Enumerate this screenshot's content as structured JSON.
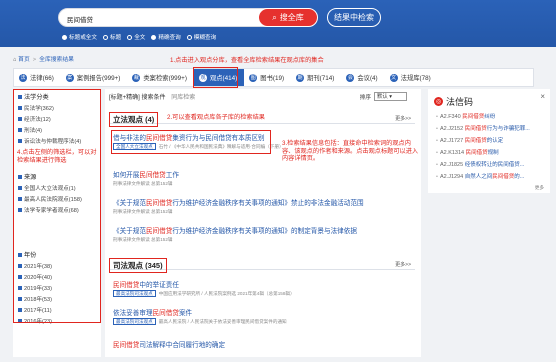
{
  "search": {
    "value": "民间借贷",
    "button": "搜全库",
    "within": "结果中检索"
  },
  "search_options": [
    {
      "label": "标题或全文",
      "checked": true
    },
    {
      "label": "标题",
      "checked": false
    },
    {
      "label": "全文",
      "checked": false
    },
    {
      "label": "精确查询",
      "checked": true
    },
    {
      "label": "模糊查询",
      "checked": false
    }
  ],
  "breadcrumb": {
    "home": "首页",
    "current": "全库搜索结果"
  },
  "annotations": {
    "a1": "1.点击进入观点分库，查看全库检索结果在观点库的集合",
    "a2": "2.可以查看观点库各子库的检索结果",
    "a3": "3.检索结果信息包括：直接命中检索词的观点内容、该观点的作者和来源。点击观点标题可以进入内容详情页。",
    "a4": "4.点击左侧的筛选栏，可以对检索结果进行筛选"
  },
  "tabs": [
    {
      "icon": "法",
      "label": "法律(66)"
    },
    {
      "icon": "案",
      "label": "案例报告(999+)"
    },
    {
      "icon": "裁",
      "label": "类案检索(999+)"
    },
    {
      "icon": "观",
      "label": "观点(414)",
      "active": true
    },
    {
      "icon": "图",
      "label": "图书(19)"
    },
    {
      "icon": "期",
      "label": "期刊(714)"
    },
    {
      "icon": "会",
      "label": "会议(4)"
    },
    {
      "icon": "文",
      "label": "法规库(78)"
    }
  ],
  "toolbar": {
    "left": "[标题+精确] 搜索条件",
    "tip": "同库检索",
    "sort_label": "排序",
    "sort_value": "默认"
  },
  "sidebar": {
    "group1": {
      "title": "法学分类",
      "items": [
        "民法学(362)",
        "经济法(12)",
        "刑法(4)",
        "诉讼法与仲裁程序法(4)"
      ]
    },
    "group2": {
      "title": "来源",
      "items": [
        "全国人大立法观点(1)",
        "最高人民法院观点(158)",
        "法学专家学者观点(68)"
      ]
    },
    "group3": {
      "title": "年份",
      "items": [
        "2021年(38)",
        "2020年(40)",
        "2019年(33)",
        "2018年(53)",
        "2017年(11)",
        "2016年(23)"
      ]
    }
  },
  "sections": [
    {
      "title": "立法观点 (4)",
      "more": "更多>>",
      "results": [
        {
          "pre": "借与非法的",
          "kw": "民间借贷",
          "post": "集资行为与民间借贷有本质区别",
          "tag": "全国人大立法观点",
          "meta": "石竹 / 《中华人民共和国民法典》释解与适用·合同编（下册）"
        },
        {
          "pre": "如何开展",
          "kw": "民间借贷",
          "post": "工作",
          "tag": "",
          "meta": "刑事法律文件解读 总第152辑"
        },
        {
          "pre": "《关于规范",
          "kw": "民间借贷",
          "post": "行为维护经济金融秩序有关事项的通知》禁止的非法金融活动范围",
          "tag": "",
          "meta": "刑事法律文件解读 总第152辑"
        },
        {
          "pre": "《关于规范",
          "kw": "民间借贷",
          "post": "行为维护经济金融秩序有关事项的通知》的制定背景与法律依据",
          "tag": "",
          "meta": "刑事法律文件解读 总第152辑"
        }
      ]
    },
    {
      "title": "司法观点 (345)",
      "more": "更多>>",
      "results": [
        {
          "pre": "",
          "kw": "民间借贷",
          "post": "中的举证责任",
          "tag": "最高法院司法观点",
          "meta": "中国应用法学研究所 / 人民法院案例选 2021年第4辑（总第158辑）"
        },
        {
          "pre": "依法妥善审理",
          "kw": "民间借贷",
          "post": "案件",
          "tag": "最高法院司法观点",
          "meta": "最高人民法院 / 人民法院关于依法妥善审理民间借贷案件的通知"
        },
        {
          "pre": "",
          "kw": "民间借贷",
          "post": "司法解释中合同履行地的确定",
          "tag": "",
          "meta": ""
        }
      ]
    }
  ],
  "right_panel": {
    "title": "法信码",
    "items": [
      {
        "code": "A2.F340",
        "pre": "",
        "kw": "民间借贷",
        "post": "纠纷"
      },
      {
        "code": "A2.J2152",
        "pre": "",
        "kw": "民间借贷",
        "post": "行为与诈骗犯罪..."
      },
      {
        "code": "A2.J1727",
        "pre": "",
        "kw": "民间借贷",
        "post": "的认定"
      },
      {
        "code": "A2.K1314",
        "pre": "",
        "kw": "民间借贷",
        "post": "规制"
      },
      {
        "code": "A2.J1825",
        "pre": "经债权转让",
        "kw": "",
        "post": "的民间借贷..."
      },
      {
        "code": "A2.J1294",
        "pre": "自然人之间",
        "kw": "民间借贷",
        "post": "的..."
      }
    ],
    "more": "更多"
  }
}
